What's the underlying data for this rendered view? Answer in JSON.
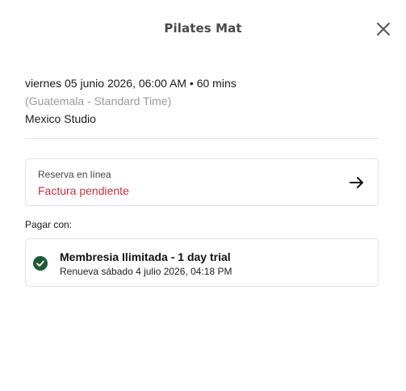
{
  "modal": {
    "title": "Pilates Mat",
    "close_icon": "close-icon"
  },
  "class_details": {
    "datetime": "viernes 05 junio 2026, 06:00 AM • 60 mins",
    "timezone": "(Guatemala - Standard Time)",
    "location": "Mexico Studio"
  },
  "booking": {
    "label": "Reserva en línea",
    "status": "Factura pendiente",
    "status_color": "#d62d3f",
    "icon": "arrow-right-icon"
  },
  "payment": {
    "label": "Pagar con:",
    "membership_name": "Membresia Ilimitada - 1 day trial",
    "renewal": "Renueva sábado 4 julio 2026, 04:18 PM",
    "selected_icon": "check-circle-icon",
    "selected_color": "#1e5b35"
  }
}
